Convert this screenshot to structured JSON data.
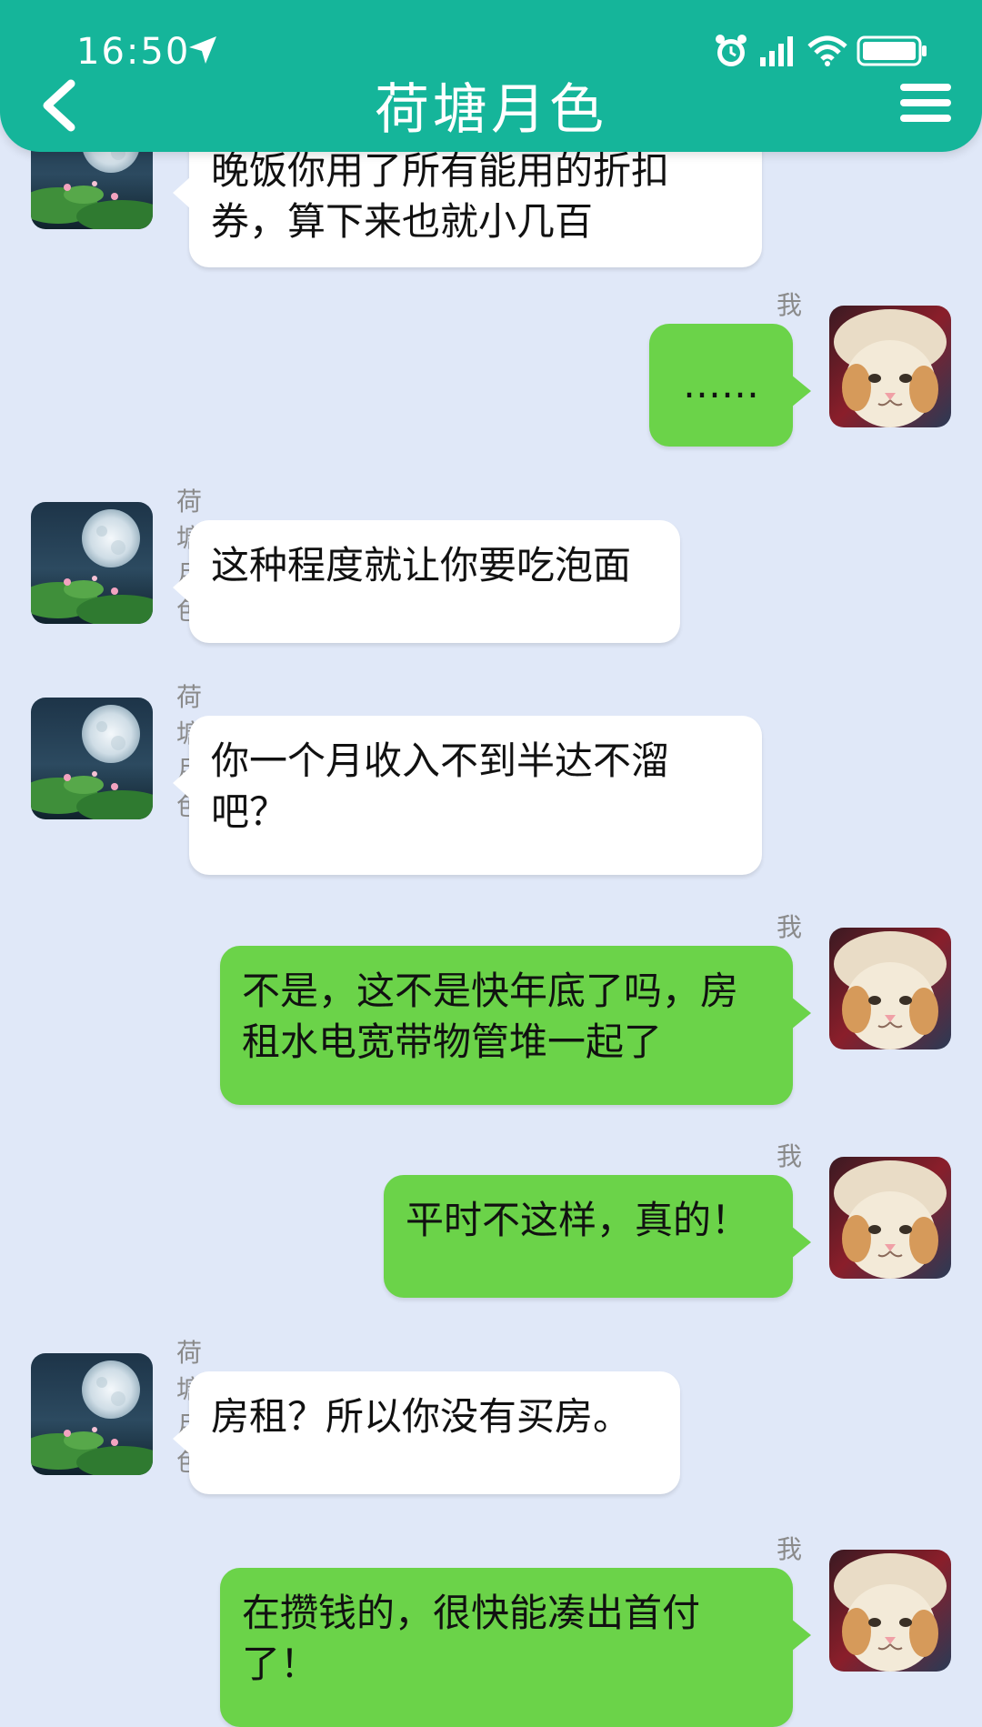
{
  "status_bar": {
    "time": "16:50"
  },
  "header": {
    "title": "荷塘月色"
  },
  "contact_name": "荷塘月色",
  "me_name": "我",
  "messages": [
    {
      "side": "left",
      "text": "晚饭你用了所有能用的折扣券，算下来也就小几百"
    },
    {
      "side": "right",
      "text": "……"
    },
    {
      "side": "left",
      "text": "这种程度就让你要吃泡面"
    },
    {
      "side": "left",
      "text": "你一个月收入不到半达不溜吧？"
    },
    {
      "side": "right",
      "text": "不是，这不是快年底了吗，房租水电宽带物管堆一起了"
    },
    {
      "side": "right",
      "text": "平时不这样，真的！"
    },
    {
      "side": "left",
      "text": "房租？所以你没有买房。"
    },
    {
      "side": "right",
      "text": "在攒钱的，很快能凑出首付了！"
    }
  ]
}
